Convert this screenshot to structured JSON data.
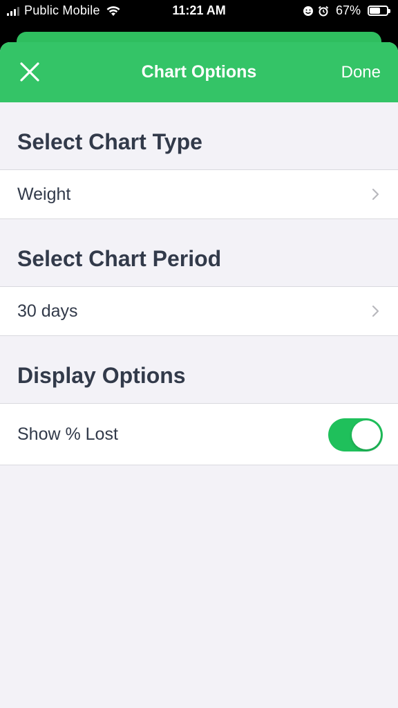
{
  "status_bar": {
    "carrier": "Public Mobile",
    "time": "11:21 AM",
    "battery_percent": "67%",
    "battery_level": 0.67
  },
  "nav": {
    "close_icon": "close-icon",
    "title": "Chart Options",
    "done_label": "Done"
  },
  "sections": {
    "chart_type": {
      "header": "Select Chart Type",
      "value": "Weight"
    },
    "chart_period": {
      "header": "Select Chart Period",
      "value": "30 days"
    },
    "display_options": {
      "header": "Display Options",
      "show_lost_label": "Show % Lost",
      "show_lost_enabled": true
    }
  },
  "colors": {
    "accent_green": "#34c467",
    "toggle_on": "#1fc05b",
    "text_dark": "#323a4a",
    "background": "#f3f2f7"
  }
}
